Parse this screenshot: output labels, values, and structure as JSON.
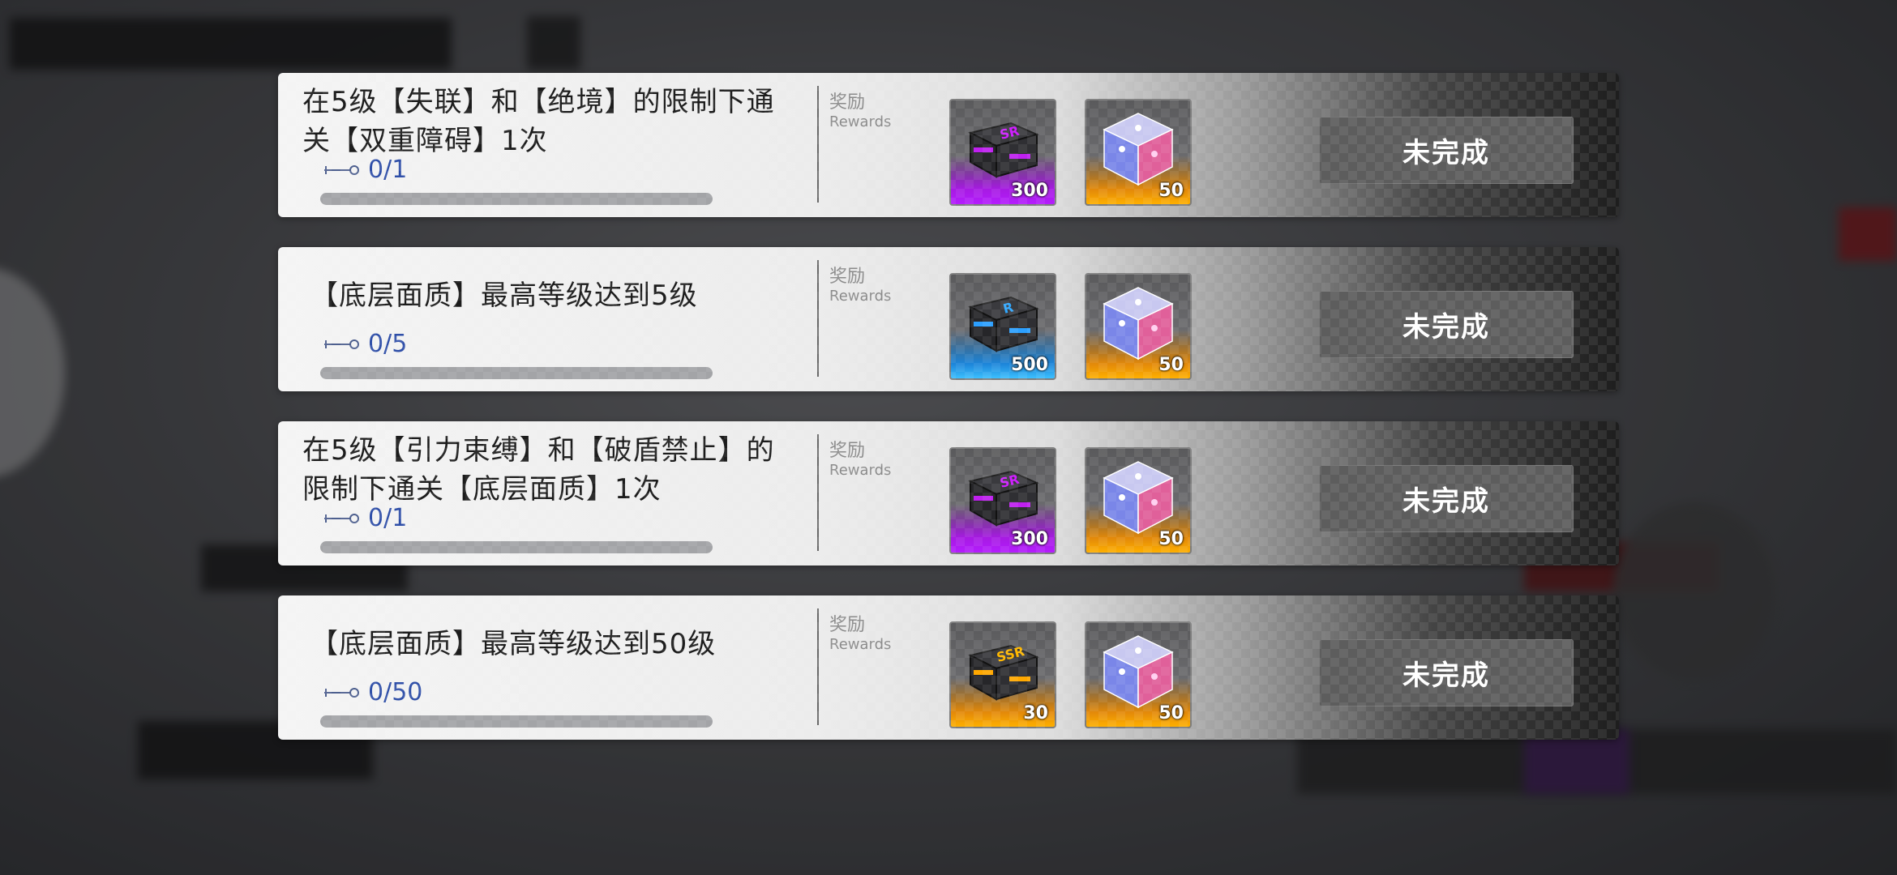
{
  "theme": {
    "progress_color": "#2f4fa8",
    "button_bg": "#5d5d5d"
  },
  "rewards_label_zh": "奖励",
  "rewards_label_en": "Rewards",
  "tasks": [
    {
      "title": "在5级【失联】和【绝境】的限制下通关【双重障碍】1次",
      "progress_text": "0/1",
      "progress_fraction": 0,
      "status": "未完成",
      "rewards": [
        {
          "icon": "purple-crate-icon",
          "rarity": "purple",
          "count": "300"
        },
        {
          "icon": "crystal-cube-icon",
          "rarity": "orange",
          "count": "50"
        }
      ]
    },
    {
      "title": "【底层面质】最高等级达到5级",
      "progress_text": "0/5",
      "progress_fraction": 0,
      "status": "未完成",
      "rewards": [
        {
          "icon": "blue-crate-icon",
          "rarity": "blue",
          "count": "500"
        },
        {
          "icon": "crystal-cube-icon",
          "rarity": "orange",
          "count": "50"
        }
      ]
    },
    {
      "title": "在5级【引力束缚】和【破盾禁止】的限制下通关【底层面质】1次",
      "progress_text": "0/1",
      "progress_fraction": 0,
      "status": "未完成",
      "rewards": [
        {
          "icon": "purple-crate-icon",
          "rarity": "purple",
          "count": "300"
        },
        {
          "icon": "crystal-cube-icon",
          "rarity": "orange",
          "count": "50"
        }
      ]
    },
    {
      "title": "【底层面质】最高等级达到50级",
      "progress_text": "0/50",
      "progress_fraction": 0,
      "status": "未完成",
      "rewards": [
        {
          "icon": "ssr-crate-icon",
          "rarity": "orange",
          "count": "30"
        },
        {
          "icon": "crystal-cube-icon",
          "rarity": "orange",
          "count": "50"
        }
      ]
    }
  ]
}
